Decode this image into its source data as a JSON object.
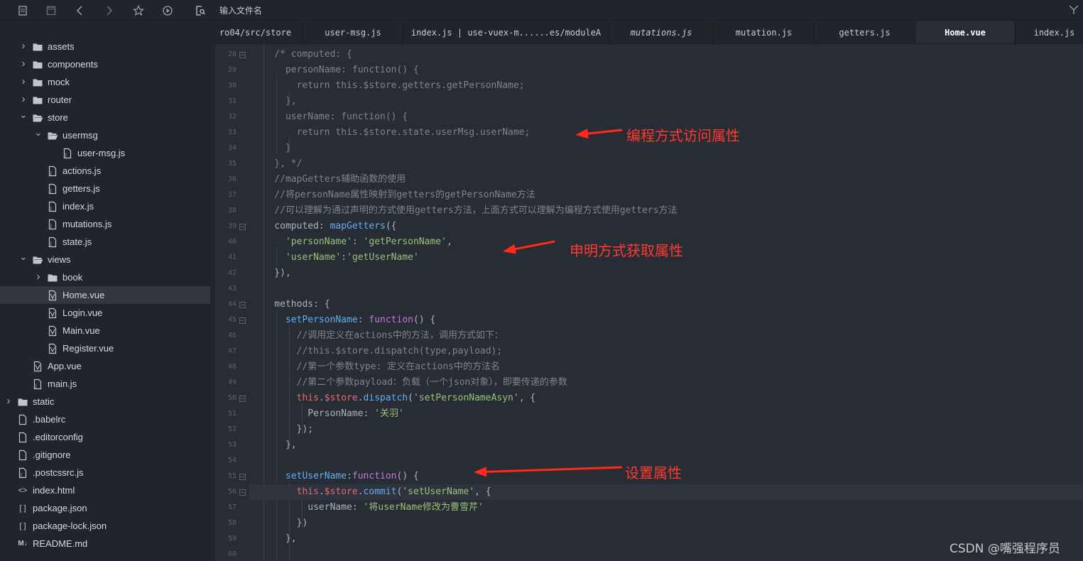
{
  "toolbar": {
    "file_input_placeholder": "输入文件名",
    "buttons": [
      "outline-icon",
      "save-icon",
      "back-arrow-icon",
      "forward-arrow-icon",
      "star-icon",
      "play-icon",
      "file-search-icon"
    ]
  },
  "sidebar": {
    "items": [
      {
        "label": "assets",
        "type": "folder",
        "expanded": false,
        "depth": 2
      },
      {
        "label": "components",
        "type": "folder",
        "expanded": false,
        "depth": 2
      },
      {
        "label": "mock",
        "type": "folder",
        "expanded": false,
        "depth": 2
      },
      {
        "label": "router",
        "type": "folder",
        "expanded": false,
        "depth": 2
      },
      {
        "label": "store",
        "type": "folder",
        "expanded": true,
        "depth": 2
      },
      {
        "label": "usermsg",
        "type": "folder",
        "expanded": true,
        "depth": 3
      },
      {
        "label": "user-msg.js",
        "type": "js",
        "depth": 4
      },
      {
        "label": "actions.js",
        "type": "js",
        "depth": 3
      },
      {
        "label": "getters.js",
        "type": "js",
        "depth": 3
      },
      {
        "label": "index.js",
        "type": "js",
        "depth": 3
      },
      {
        "label": "mutations.js",
        "type": "js",
        "depth": 3
      },
      {
        "label": "state.js",
        "type": "js",
        "depth": 3
      },
      {
        "label": "views",
        "type": "folder",
        "expanded": true,
        "depth": 2
      },
      {
        "label": "book",
        "type": "folder",
        "expanded": false,
        "depth": 3
      },
      {
        "label": "Home.vue",
        "type": "vue",
        "depth": 3,
        "selected": true
      },
      {
        "label": "Login.vue",
        "type": "vue",
        "depth": 3
      },
      {
        "label": "Main.vue",
        "type": "vue",
        "depth": 3
      },
      {
        "label": "Register.vue",
        "type": "vue",
        "depth": 3
      },
      {
        "label": "App.vue",
        "type": "vue",
        "depth": 2
      },
      {
        "label": "main.js",
        "type": "js",
        "depth": 2
      },
      {
        "label": "static",
        "type": "folder",
        "expanded": false,
        "depth": 1
      },
      {
        "label": ".babelrc",
        "type": "file",
        "depth": 1
      },
      {
        "label": ".editorconfig",
        "type": "file",
        "depth": 1
      },
      {
        "label": ".gitignore",
        "type": "file",
        "depth": 1
      },
      {
        "label": ".postcssrc.js",
        "type": "js",
        "depth": 1
      },
      {
        "label": "index.html",
        "type": "html",
        "depth": 1
      },
      {
        "label": "package.json",
        "type": "json",
        "depth": 1
      },
      {
        "label": "package-lock.json",
        "type": "json",
        "depth": 1
      },
      {
        "label": "README.md",
        "type": "md",
        "depth": 1
      }
    ]
  },
  "tabs": [
    {
      "label": "ro04/src/store",
      "active": false,
      "italic": false
    },
    {
      "label": "user-msg.js",
      "active": false,
      "italic": false
    },
    {
      "label": "index.js | use-vuex-m......es/moduleA",
      "active": false,
      "italic": false
    },
    {
      "label": "mutations.js",
      "active": false,
      "italic": true
    },
    {
      "label": "mutation.js",
      "active": false,
      "italic": false
    },
    {
      "label": "getters.js",
      "active": false,
      "italic": false
    },
    {
      "label": "Home.vue",
      "active": true,
      "italic": false
    },
    {
      "label": "index.js",
      "active": false,
      "italic": false
    }
  ],
  "editor": {
    "lines": [
      {
        "n": "28",
        "fold": true,
        "parts": [
          [
            "c-com",
            "    /* computed: {"
          ]
        ]
      },
      {
        "n": "29",
        "fold": false,
        "parts": [
          [
            "c-com",
            "      personName: function() {"
          ]
        ]
      },
      {
        "n": "30",
        "fold": false,
        "parts": [
          [
            "c-com",
            "        return this.$store.getters.getPersonName;"
          ]
        ]
      },
      {
        "n": "31",
        "fold": false,
        "parts": [
          [
            "c-com",
            "      },"
          ]
        ]
      },
      {
        "n": "32",
        "fold": false,
        "parts": [
          [
            "c-com",
            "      userName: function() {"
          ]
        ]
      },
      {
        "n": "33",
        "fold": false,
        "parts": [
          [
            "c-com",
            "        return this.$store.state.userMsg.userName;"
          ]
        ]
      },
      {
        "n": "34",
        "fold": false,
        "parts": [
          [
            "c-com",
            "      }"
          ]
        ]
      },
      {
        "n": "35",
        "fold": false,
        "parts": [
          [
            "c-com",
            "    }, */"
          ]
        ]
      },
      {
        "n": "36",
        "fold": false,
        "parts": [
          [
            "c-com",
            "    //mapGetters辅助函数的使用"
          ]
        ]
      },
      {
        "n": "37",
        "fold": false,
        "parts": [
          [
            "c-com",
            "    //将personName属性映射到getters的getPersonName方法"
          ]
        ]
      },
      {
        "n": "38",
        "fold": false,
        "parts": [
          [
            "c-com",
            "    //可以理解为通过声明的方式使用getters方法，上面方式可以理解为编程方式使用getters方法"
          ]
        ]
      },
      {
        "n": "39",
        "fold": true,
        "parts": [
          [
            "c-plain",
            "    computed: "
          ],
          [
            "c-key",
            "mapGetters"
          ],
          [
            "c-plain",
            "({"
          ]
        ]
      },
      {
        "n": "40",
        "fold": false,
        "parts": [
          [
            "c-str",
            "      'personName'"
          ],
          [
            "c-plain",
            ": "
          ],
          [
            "c-str",
            "'getPersonName'"
          ],
          [
            "c-plain",
            ","
          ]
        ]
      },
      {
        "n": "41",
        "fold": false,
        "parts": [
          [
            "c-str",
            "      'userName'"
          ],
          [
            "c-plain",
            ":"
          ],
          [
            "c-str",
            "'getUserName'"
          ]
        ]
      },
      {
        "n": "42",
        "fold": false,
        "parts": [
          [
            "c-plain",
            "    }),"
          ]
        ]
      },
      {
        "n": "43",
        "fold": false,
        "parts": [
          [
            "c-plain",
            ""
          ]
        ]
      },
      {
        "n": "44",
        "fold": true,
        "parts": [
          [
            "c-plain",
            "    methods: {"
          ]
        ]
      },
      {
        "n": "45",
        "fold": true,
        "parts": [
          [
            "c-key",
            "      setPersonName"
          ],
          [
            "c-plain",
            ": "
          ],
          [
            "c-kw",
            "function"
          ],
          [
            "c-plain",
            "() {"
          ]
        ]
      },
      {
        "n": "46",
        "fold": false,
        "parts": [
          [
            "c-com",
            "        //调用定义在actions中的方法，调用方式如下："
          ]
        ]
      },
      {
        "n": "47",
        "fold": false,
        "parts": [
          [
            "c-com",
            "        //this.$store.dispatch(type,payload);"
          ]
        ]
      },
      {
        "n": "48",
        "fold": false,
        "parts": [
          [
            "c-com",
            "        //第一个参数type: 定义在actions中的方法名"
          ]
        ]
      },
      {
        "n": "49",
        "fold": false,
        "parts": [
          [
            "c-com",
            "        //第二个参数payload：负载（一个json对象），即要传递的参数"
          ]
        ]
      },
      {
        "n": "50",
        "fold": true,
        "parts": [
          [
            "c-var",
            "        this"
          ],
          [
            "c-plain",
            "."
          ],
          [
            "c-var",
            "$store"
          ],
          [
            "c-plain",
            "."
          ],
          [
            "c-key",
            "dispatch"
          ],
          [
            "c-plain",
            "("
          ],
          [
            "c-str",
            "'setPersonNameAsyn'"
          ],
          [
            "c-plain",
            ", {"
          ]
        ]
      },
      {
        "n": "51",
        "fold": false,
        "parts": [
          [
            "c-plain",
            "          PersonName: "
          ],
          [
            "c-str",
            "'关羽'"
          ]
        ]
      },
      {
        "n": "52",
        "fold": false,
        "parts": [
          [
            "c-plain",
            "        });"
          ]
        ]
      },
      {
        "n": "53",
        "fold": false,
        "parts": [
          [
            "c-plain",
            "      },"
          ]
        ]
      },
      {
        "n": "54",
        "fold": false,
        "parts": [
          [
            "c-plain",
            ""
          ]
        ]
      },
      {
        "n": "55",
        "fold": true,
        "parts": [
          [
            "c-key",
            "      setUserName"
          ],
          [
            "c-plain",
            ":"
          ],
          [
            "c-kw",
            "function"
          ],
          [
            "c-plain",
            "() {"
          ]
        ]
      },
      {
        "n": "56",
        "fold": true,
        "highlight": true,
        "parts": [
          [
            "c-var",
            "        this"
          ],
          [
            "c-plain",
            "."
          ],
          [
            "c-var",
            "$store"
          ],
          [
            "c-plain",
            "."
          ],
          [
            "c-key",
            "commit"
          ],
          [
            "c-plain",
            "("
          ],
          [
            "c-str",
            "'setUserName'"
          ],
          [
            "c-plain",
            ", {"
          ]
        ]
      },
      {
        "n": "57",
        "fold": false,
        "parts": [
          [
            "c-plain",
            "          userName: "
          ],
          [
            "c-str",
            "'将userName修改为曹雪芹'"
          ]
        ]
      },
      {
        "n": "58",
        "fold": false,
        "parts": [
          [
            "c-plain",
            "        })"
          ]
        ]
      },
      {
        "n": "59",
        "fold": false,
        "parts": [
          [
            "c-plain",
            "      },"
          ]
        ]
      },
      {
        "n": "60",
        "fold": false,
        "parts": [
          [
            "c-plain",
            ""
          ]
        ]
      }
    ]
  },
  "annotations": {
    "programmatic": "编程方式访问属性",
    "declarative": "申明方式获取属性",
    "set": "设置属性",
    "color": "#ff2a1a"
  },
  "watermark": "CSDN @嘴强程序员"
}
